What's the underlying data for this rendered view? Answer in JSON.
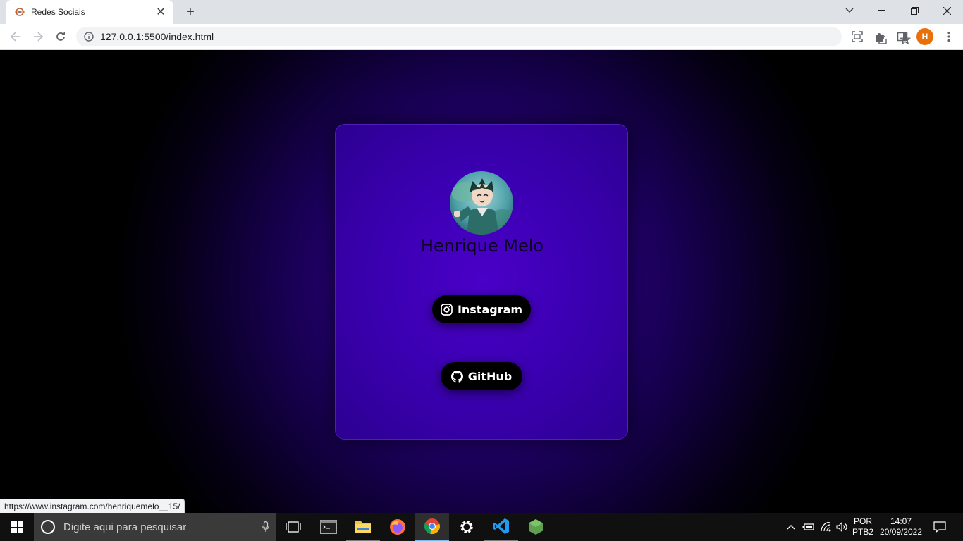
{
  "browser": {
    "tab": {
      "title": "Redes Sociais"
    },
    "address_bar": {
      "url": "127.0.0.1:5500/index.html"
    },
    "profile_initial": "H",
    "status_bar_url": "https://www.instagram.com/henriquemelo__15/"
  },
  "page": {
    "profile": {
      "name": "Henrique Melo"
    },
    "buttons": {
      "instagram": "Instagram",
      "github": "GitHub"
    }
  },
  "taskbar": {
    "search_placeholder": "Digite aqui para pesquisar",
    "language": {
      "line1": "POR",
      "line2": "PTB2"
    },
    "clock": {
      "time": "14:07",
      "date": "20/09/2022"
    }
  },
  "colors": {
    "background_center": "#3d00a8",
    "card": "#3a00b0",
    "button": "#000000",
    "profile_avatar": "#e8710a"
  }
}
